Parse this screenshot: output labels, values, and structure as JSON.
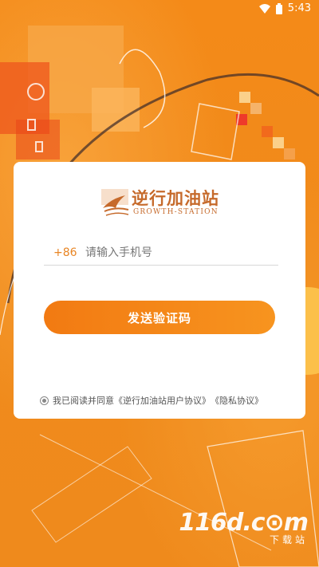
{
  "status_bar": {
    "time": "5:43"
  },
  "brand": {
    "name": "逆行加油站",
    "subtitle": "GROWTH-STATION"
  },
  "phone": {
    "country_code": "+86",
    "placeholder": "请输入手机号"
  },
  "send_button": {
    "label": "发送验证码"
  },
  "agreement": {
    "prefix": "我已阅读并同意",
    "user_agreement": "《逆行加油站用户协议》",
    "privacy_policy": "《隐私协议》"
  },
  "watermark": {
    "brand": "116d.c⊙m",
    "tagline": "下载站"
  },
  "colors": {
    "primary": "#f28a1a",
    "logo": "#c66a2b"
  }
}
